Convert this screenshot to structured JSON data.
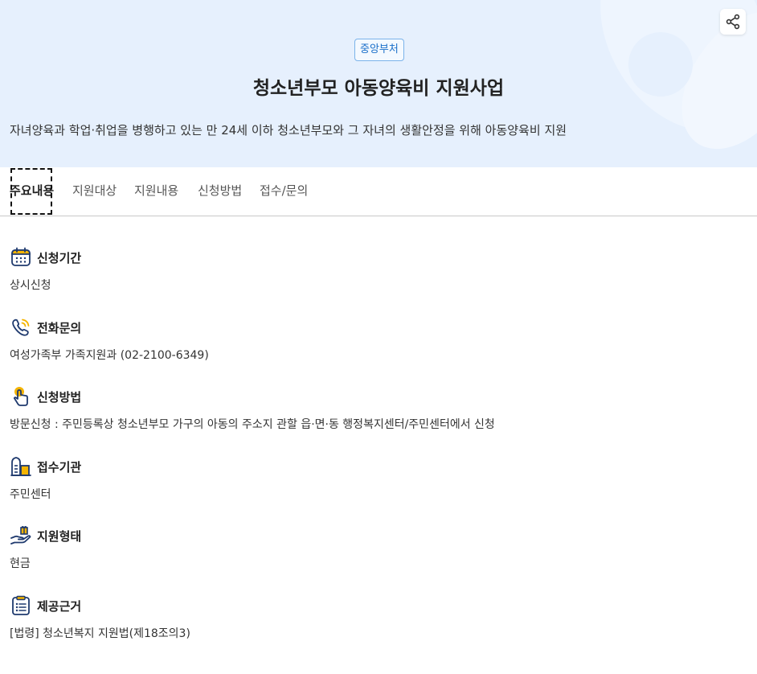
{
  "hero": {
    "badge": "중앙부처",
    "title": "청소년부모 아동양육비 지원사업",
    "description": "자녀양육과 학업·취업을 병행하고 있는 만 24세 이하 청소년부모와 그 자녀의 생활안정을 위해 아동양육비 지원",
    "share_icon": "share-icon"
  },
  "tabs": [
    {
      "label": "주요내용",
      "active": true
    },
    {
      "label": "지원대상",
      "active": false
    },
    {
      "label": "지원내용",
      "active": false
    },
    {
      "label": "신청방법",
      "active": false
    },
    {
      "label": "접수/문의",
      "active": false
    }
  ],
  "sections": [
    {
      "icon": "calendar-icon",
      "title": "신청기간",
      "body": "상시신청"
    },
    {
      "icon": "phone-icon",
      "title": "전화문의",
      "body": "여성가족부 가족지원과 (02-2100-6349)"
    },
    {
      "icon": "hand-pointer-icon",
      "title": "신청방법",
      "body": "방문신청 : 주민등록상 청소년부모 가구의 아동의 주소지 관할 읍·면·동 행정복지센터/주민센터에서 신청"
    },
    {
      "icon": "building-icon",
      "title": "접수기관",
      "body": "주민센터"
    },
    {
      "icon": "hand-gift-icon",
      "title": "지원형태",
      "body": "현금"
    },
    {
      "icon": "clipboard-icon",
      "title": "제공근거",
      "body": "[법령] 청소년복지 지원법(제18조의3)"
    }
  ],
  "colors": {
    "hero_bg": "#e6f0fd",
    "accent": "#1a6fc9",
    "icon_navy": "#1f3a6e",
    "icon_yellow": "#f4b400"
  }
}
